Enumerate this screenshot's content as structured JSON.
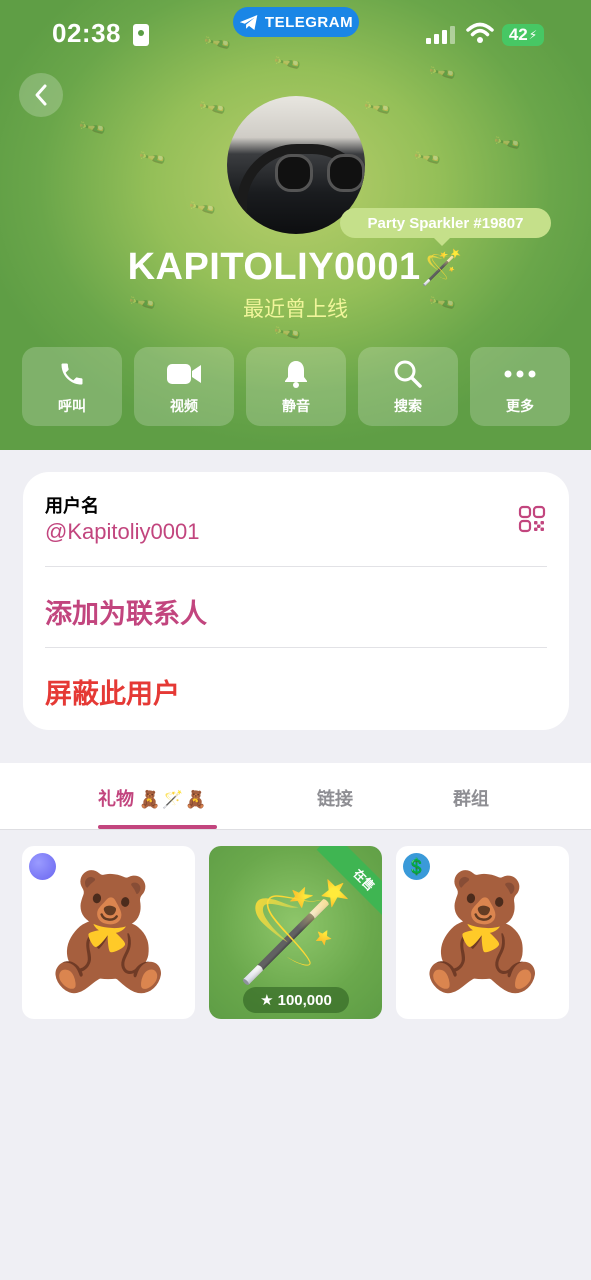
{
  "statusbar": {
    "time": "02:38",
    "pill_label": "TELEGRAM",
    "battery": "42"
  },
  "profile": {
    "gift_tag": "Party Sparkler #19807",
    "name": "KAPITOLIY0001",
    "name_emoji": "🪄",
    "status": "最近曾上线"
  },
  "actions": [
    {
      "label": "呼叫",
      "icon": "phone-icon"
    },
    {
      "label": "视频",
      "icon": "video-icon"
    },
    {
      "label": "静音",
      "icon": "bell-icon"
    },
    {
      "label": "搜索",
      "icon": "search-icon"
    },
    {
      "label": "更多",
      "icon": "more-icon"
    }
  ],
  "info": {
    "username_label": "用户名",
    "username": "@Kapitoliy0001",
    "add_contact": "添加为联系人",
    "block_user": "屏蔽此用户"
  },
  "tabs": [
    {
      "label": "礼物",
      "emojis": "🧸🪄🧸",
      "active": true
    },
    {
      "label": "链接",
      "active": false
    },
    {
      "label": "群组",
      "active": false
    }
  ],
  "gifts": [
    {
      "name": "teddy-bear",
      "emoji": "🧸",
      "badge_color": "#7d7cf6"
    },
    {
      "name": "party-sparkler",
      "emoji": "🪄",
      "ribbon": "在售",
      "price": "100,000"
    },
    {
      "name": "teddy-bear",
      "emoji": "🧸",
      "badge_icon": "💲"
    }
  ],
  "colors": {
    "accent": "#c2457e",
    "danger": "#e53935",
    "header_green": "#6aa64a",
    "online_text": "#f0f59a",
    "telegram_blue": "#1a86e6"
  }
}
